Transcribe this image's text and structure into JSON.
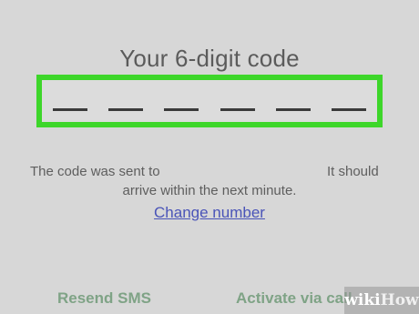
{
  "screen": {
    "title": "Your 6-digit code",
    "code_slots": [
      "",
      "",
      "",
      "",
      "",
      ""
    ],
    "info_line1_start": "The code was sent to",
    "info_line1_end": "It should",
    "info_line2": "arrive within the next minute.",
    "change_number_link": "Change number"
  },
  "actions": {
    "resend_sms": "Resend SMS",
    "activate_via_call": "Activate via call"
  },
  "watermark": {
    "part1": "wiki",
    "part2": "How"
  },
  "colors": {
    "background": "#d7d7d7",
    "highlight_border": "#3dd62a",
    "link": "#4a54b8",
    "action_text": "#7fa386"
  }
}
